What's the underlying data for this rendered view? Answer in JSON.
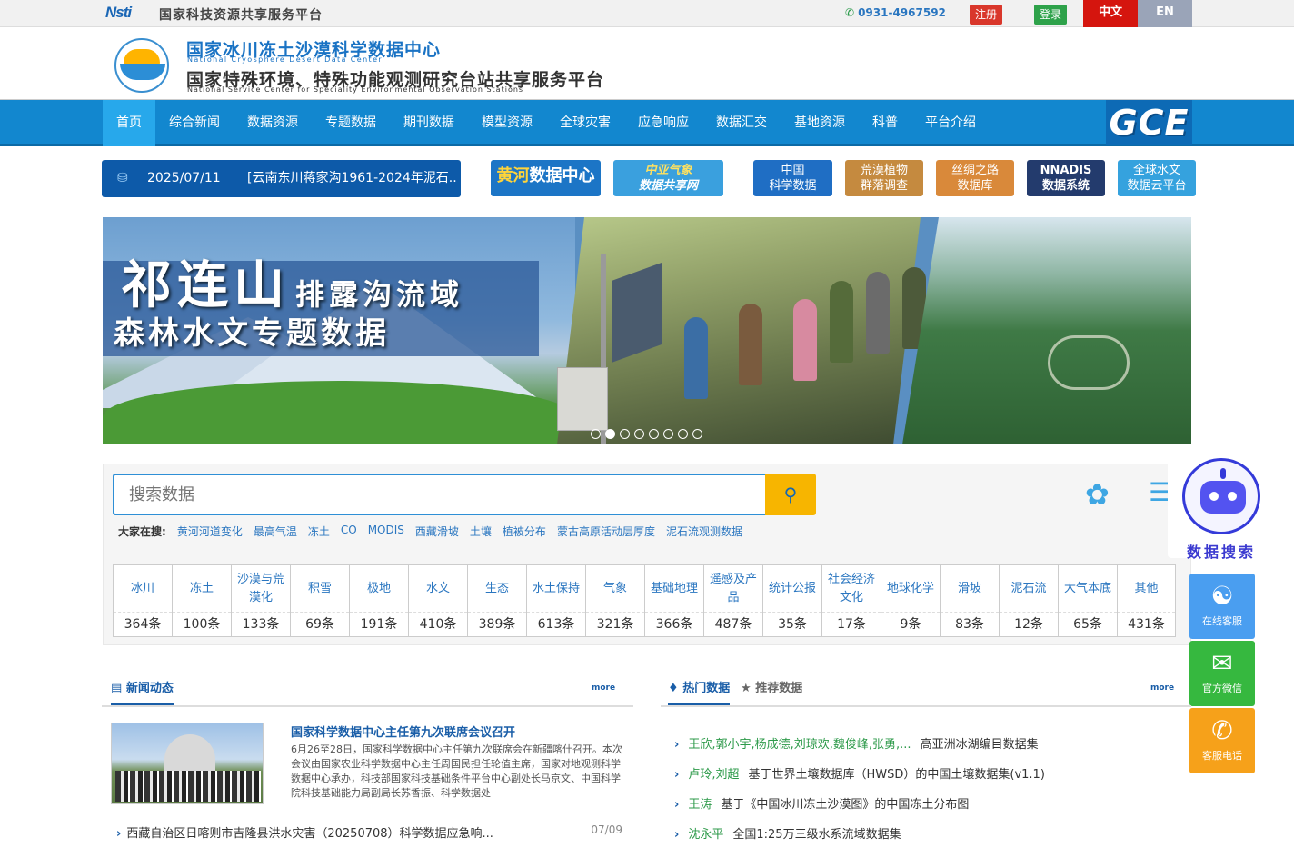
{
  "topbar": {
    "nsti_logo": "Nsti",
    "platform_name": "国家科技资源共享服务平台",
    "phone": "0931-4967592",
    "register": "注册",
    "login": "登录",
    "lang_zh": "中文",
    "lang_en": "EN"
  },
  "header": {
    "title1": "国家冰川冻土沙漠科学数据中心",
    "subtitle1": "National Cryosphere Desert Data Center",
    "title2": "国家特殊环境、特殊功能观测研究台站共享服务平台",
    "subtitle2": "National Service Center for Speciality Environmental Observation Stations"
  },
  "nav": {
    "items": [
      "首页",
      "综合新闻",
      "数据资源",
      "专题数据",
      "期刊数据",
      "模型资源",
      "全球灾害",
      "应急响应",
      "数据汇交",
      "基地资源",
      "科普",
      "平台介绍"
    ],
    "gce": "GCE"
  },
  "ticker": {
    "date": "2025/07/11",
    "text": "[云南东川蒋家沟1961-2024年泥石..."
  },
  "partners": {
    "p1_a": "黄河",
    "p1_b": "数据中心",
    "p2_a": "中亚气象",
    "p2_b": "数据共享网",
    "p3": [
      "中国",
      "科学数据"
    ],
    "p4": [
      "荒漠植物",
      "群落调查"
    ],
    "p5": [
      "丝绸之路",
      "数据库"
    ],
    "p6": [
      "NNADIS",
      "数据系统"
    ],
    "p7": [
      "全球水文",
      "数据云平台"
    ]
  },
  "banner": {
    "t1": "祁连山",
    "t2": "排露沟流域",
    "t3": "森林水文专题数据",
    "dot_count": 8,
    "active_dot": 2
  },
  "search": {
    "placeholder": "搜索数据",
    "hot_label": "大家在搜:",
    "hot_keywords": [
      "黄河河道变化",
      "最高气温",
      "冻土",
      "CO",
      "MODIS",
      "西藏滑坡",
      "土壤",
      "植被分布",
      "蒙古高原活动层厚度",
      "泥石流观测数据"
    ]
  },
  "categories": [
    {
      "name": "冰川",
      "count": "364条"
    },
    {
      "name": "冻土",
      "count": "100条"
    },
    {
      "name": "沙漠与荒漠化",
      "count": "133条"
    },
    {
      "name": "积雪",
      "count": "69条"
    },
    {
      "name": "极地",
      "count": "191条"
    },
    {
      "name": "水文",
      "count": "410条"
    },
    {
      "name": "生态",
      "count": "389条"
    },
    {
      "name": "水土保持",
      "count": "613条"
    },
    {
      "name": "气象",
      "count": "321条"
    },
    {
      "name": "基础地理",
      "count": "366条"
    },
    {
      "name": "遥感及产品",
      "count": "487条"
    },
    {
      "name": "统计公报",
      "count": "35条"
    },
    {
      "name": "社会经济文化",
      "count": "17条"
    },
    {
      "name": "地球化学",
      "count": "9条"
    },
    {
      "name": "滑坡",
      "count": "83条"
    },
    {
      "name": "泥石流",
      "count": "12条"
    },
    {
      "name": "大气本底",
      "count": "65条"
    },
    {
      "name": "其他",
      "count": "431条"
    }
  ],
  "robot": {
    "label": "数据搜索"
  },
  "side": {
    "online": "在线客服",
    "wechat": "官方微信",
    "phone": "客服电话"
  },
  "news": {
    "heading": "新闻动态",
    "more": "more",
    "feature_title": "国家科学数据中心主任第九次联席会议召开",
    "feature_body": "6月26至28日，国家科学数据中心主任第九次联席会在新疆喀什召开。本次会议由国家农业科学数据中心主任周国民担任轮值主席，国家对地观测科学数据中心承办，科技部国家科技基础条件平台中心副处长马京文、中国科学院科技基础能力局副局长苏香振、科学数据处",
    "item_title": "西藏自治区日喀则市吉隆县洪水灾害（20250708）科学数据应急响...",
    "item_date": "07/09"
  },
  "data_section": {
    "tab_hot": "热门数据",
    "tab_rec": "推荐数据",
    "more": "more",
    "items": [
      {
        "authors": "王欣,郭小宇,杨成德,刘琼欢,魏俊峰,张勇,...",
        "title": "高亚洲冰湖编目数据集"
      },
      {
        "authors": "卢玲,刘超",
        "title": "基于世界土壤数据库（HWSD）的中国土壤数据集(v1.1)"
      },
      {
        "authors": "王涛",
        "title": "基于《中国冰川冻土沙漠图》的中国冻土分布图"
      },
      {
        "authors": "沈永平",
        "title": "全国1:25万三级水系流域数据集"
      }
    ]
  },
  "colors": {
    "nav_blue": "#1287cf",
    "accent_red": "#d5150e",
    "green": "#2ea24a",
    "orange": "#f6a11a"
  }
}
